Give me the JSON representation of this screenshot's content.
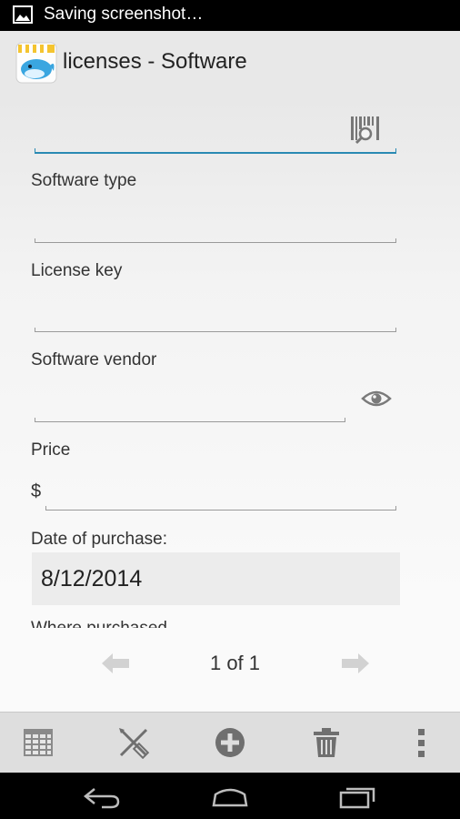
{
  "status_bar": {
    "text": "Saving screenshot…",
    "icon": "image-icon"
  },
  "action_bar": {
    "title": "licenses - Software",
    "app_icon": "whale-app-icon"
  },
  "form": {
    "name_field": {
      "value": "",
      "action_icon": "barcode-search-icon"
    },
    "software_type": {
      "label": "Software type",
      "value": ""
    },
    "license_key": {
      "label": "License key",
      "value": ""
    },
    "software_vendor": {
      "label": "Software vendor",
      "value": "",
      "action_icon": "eye-icon"
    },
    "price": {
      "label": "Price",
      "currency": "$",
      "value": ""
    },
    "date_of_purchase": {
      "label": "Date of purchase:",
      "value": "8/12/2014"
    },
    "next_label_partial": "Where purchased"
  },
  "pager": {
    "text": "1 of 1",
    "prev_icon": "arrow-left-icon",
    "next_icon": "arrow-right-icon"
  },
  "toolbar": {
    "items": [
      "grid-icon",
      "edit-tools-icon",
      "add-icon",
      "trash-icon",
      "overflow-menu-icon"
    ]
  },
  "navbar": {
    "items": [
      "back-icon",
      "home-icon",
      "recents-icon"
    ]
  },
  "colors": {
    "accent": "#2a8ab3",
    "toolbar_bg": "#dedede",
    "icon_gray": "#7a7a7a"
  }
}
